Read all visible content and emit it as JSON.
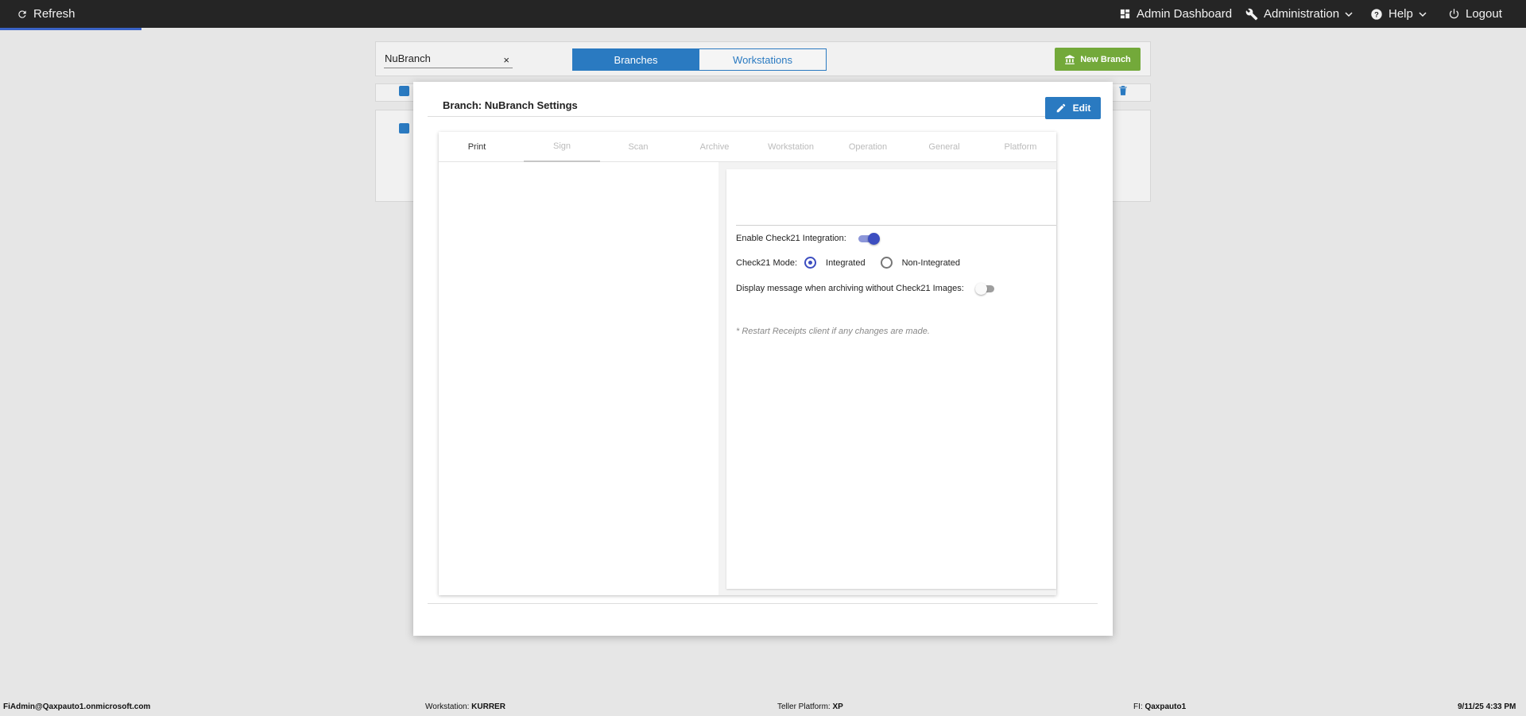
{
  "topbar": {
    "refresh_label": "Refresh",
    "admin_dashboard_label": "Admin Dashboard",
    "administration_label": "Administration",
    "help_label": "Help",
    "logout_label": "Logout"
  },
  "background": {
    "search_value": "NuBranch",
    "search_clear": "×",
    "segments": {
      "branches": "Branches",
      "workstations": "Workstations"
    },
    "new_branch_label": "New Branch"
  },
  "modal": {
    "title": "Branch: NuBranch Settings",
    "edit_label": "Edit",
    "tabs": [
      {
        "label": "Print"
      },
      {
        "label": "Sign"
      },
      {
        "label": "Scan"
      },
      {
        "label": "Archive"
      },
      {
        "label": "Workstation"
      },
      {
        "label": "Operation"
      },
      {
        "label": "General"
      },
      {
        "label": "Platform"
      }
    ],
    "settings": {
      "enable_check21_label": "Enable Check21 Integration:",
      "enable_check21_value": true,
      "mode_label": "Check21 Mode:",
      "mode_options": [
        "Integrated",
        "Non-Integrated"
      ],
      "mode_selected": "Integrated",
      "display_message_label": "Display message when archiving without Check21 Images:",
      "display_message_value": false,
      "note": "* Restart Receipts client if any changes are made."
    }
  },
  "footer": {
    "user": "FiAdmin@Qaxpauto1.onmicrosoft.com",
    "workstation_label": "Workstation:",
    "workstation_value": "KURRER",
    "platform_label": "Teller Platform:",
    "platform_value": "XP",
    "fi_label": "FI:",
    "fi_value": "Qaxpauto1",
    "datetime": "9/11/25 4:33 PM"
  },
  "colors": {
    "topbar_bg": "#252525",
    "primary_blue": "#2a7ac1",
    "toggle_accent": "#3d4ec0",
    "new_branch_green": "#73a93a"
  }
}
